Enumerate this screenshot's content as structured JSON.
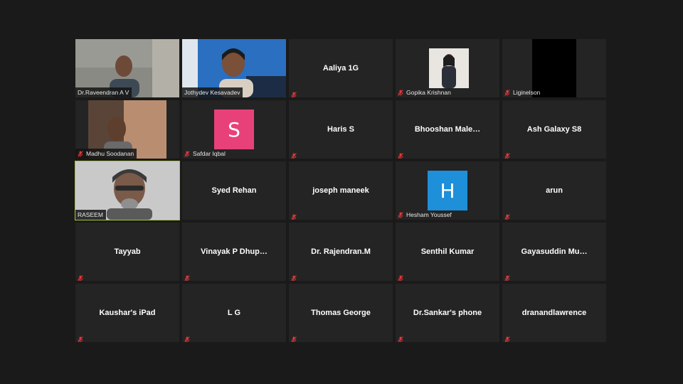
{
  "participants": [
    {
      "name": "Dr.Raveendran A V",
      "type": "video",
      "muted": false
    },
    {
      "name": "Jothydev Kesavadev",
      "type": "video",
      "muted": false
    },
    {
      "name": "Aaliya 1G",
      "type": "name",
      "muted": true
    },
    {
      "name": "Gopika Krishnan",
      "type": "photo",
      "muted": true
    },
    {
      "name": "Liginelson",
      "type": "black",
      "muted": true
    },
    {
      "name": "Madhu Soodanan",
      "type": "video",
      "muted": true
    },
    {
      "name": "Safdar Iqbal",
      "type": "avatar",
      "initial": "S",
      "avatar_color": "#e8417a",
      "muted": true
    },
    {
      "name": "Haris S",
      "type": "name",
      "muted": true
    },
    {
      "name": "Bhooshan  Male…",
      "type": "name",
      "muted": true
    },
    {
      "name": "Ash Galaxy S8",
      "type": "name",
      "muted": true
    },
    {
      "name": "RASEEM",
      "type": "video",
      "muted": false,
      "active": true
    },
    {
      "name": "Syed Rehan",
      "type": "name",
      "muted": false
    },
    {
      "name": "joseph maneek",
      "type": "name",
      "muted": true
    },
    {
      "name": "Hesham Youssef",
      "type": "avatar",
      "initial": "H",
      "avatar_color": "#1e8fd9",
      "muted": true
    },
    {
      "name": "arun",
      "type": "name",
      "muted": true
    },
    {
      "name": "Tayyab",
      "type": "name",
      "muted": true
    },
    {
      "name": "Vinayak  P  Dhup…",
      "type": "name",
      "muted": true
    },
    {
      "name": "Dr. Rajendran.M",
      "type": "name",
      "muted": true
    },
    {
      "name": "Senthil Kumar",
      "type": "name",
      "muted": true
    },
    {
      "name": "Gayasuddin  Mu…",
      "type": "name",
      "muted": true
    },
    {
      "name": "Kaushar's iPad",
      "type": "name",
      "muted": true
    },
    {
      "name": "L G",
      "type": "name",
      "muted": true
    },
    {
      "name": "Thomas George",
      "type": "name",
      "muted": true
    },
    {
      "name": "Dr.Sankar's phone",
      "type": "name",
      "muted": true
    },
    {
      "name": "dranandlawrence",
      "type": "name",
      "muted": true
    }
  ],
  "colors": {
    "active_border": "#a4c639",
    "mute_icon": "#e0383b",
    "tile_bg": "#242424"
  }
}
